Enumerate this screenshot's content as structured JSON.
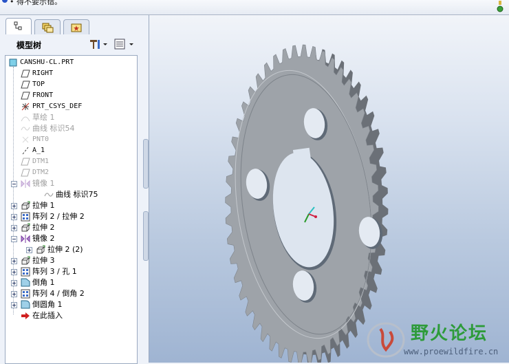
{
  "topbar": {
    "status_text": "• 得不要示错。"
  },
  "tabs": [
    {
      "name": "model-tree-tab"
    },
    {
      "name": "folder-browser-tab"
    },
    {
      "name": "favorites-tab"
    }
  ],
  "panel": {
    "title": "模型树"
  },
  "tree": {
    "items": [
      {
        "label": "CANSHU-CL.PRT",
        "icon": "part-icon"
      },
      {
        "label": "RIGHT",
        "icon": "datum-plane-icon"
      },
      {
        "label": "TOP",
        "icon": "datum-plane-icon"
      },
      {
        "label": "FRONT",
        "icon": "datum-plane-icon"
      },
      {
        "label": "PRT_CSYS_DEF",
        "icon": "csys-icon"
      },
      {
        "label": "草绘 1",
        "icon": "sketch-icon",
        "dim": true
      },
      {
        "label": "曲线 标识54",
        "icon": "curve-icon",
        "dim": true
      },
      {
        "label": "PNT0",
        "icon": "datum-point-icon",
        "dim": true
      },
      {
        "label": "A_1",
        "icon": "datum-axis-icon"
      },
      {
        "label": "DTM1",
        "icon": "datum-plane-icon",
        "dim": true
      },
      {
        "label": "DTM2",
        "icon": "datum-plane-icon",
        "dim": true
      },
      {
        "label": "镜像 1",
        "icon": "mirror-icon",
        "dim": true
      },
      {
        "label": "曲线 标识75",
        "icon": "curve-icon"
      },
      {
        "label": "拉伸 1",
        "icon": "extrude-icon"
      },
      {
        "label": "阵列 2 / 拉伸 2",
        "icon": "pattern-icon"
      },
      {
        "label": "拉伸 2",
        "icon": "extrude-icon"
      },
      {
        "label": "镜像 2",
        "icon": "mirror-icon"
      },
      {
        "label": "拉伸 2 (2)",
        "icon": "extrude-icon"
      },
      {
        "label": "拉伸 3",
        "icon": "extrude-icon"
      },
      {
        "label": "阵列 3 / 孔 1",
        "icon": "pattern-icon"
      },
      {
        "label": "倒角 1",
        "icon": "chamfer-icon"
      },
      {
        "label": "阵列 4 / 倒角 2",
        "icon": "pattern-icon"
      },
      {
        "label": "倒圆角 1",
        "icon": "round-icon"
      },
      {
        "label": "在此插入",
        "icon": "insert-here-arrow-icon"
      }
    ]
  },
  "watermark": {
    "title": "野火论坛",
    "url": "www.proewildfire.cn"
  },
  "colors": {
    "gear": "#9ea3a9",
    "gear_dark": "#6b7077",
    "viewport_top": "#f1f4f9",
    "viewport_bottom": "#9fb4d2"
  }
}
